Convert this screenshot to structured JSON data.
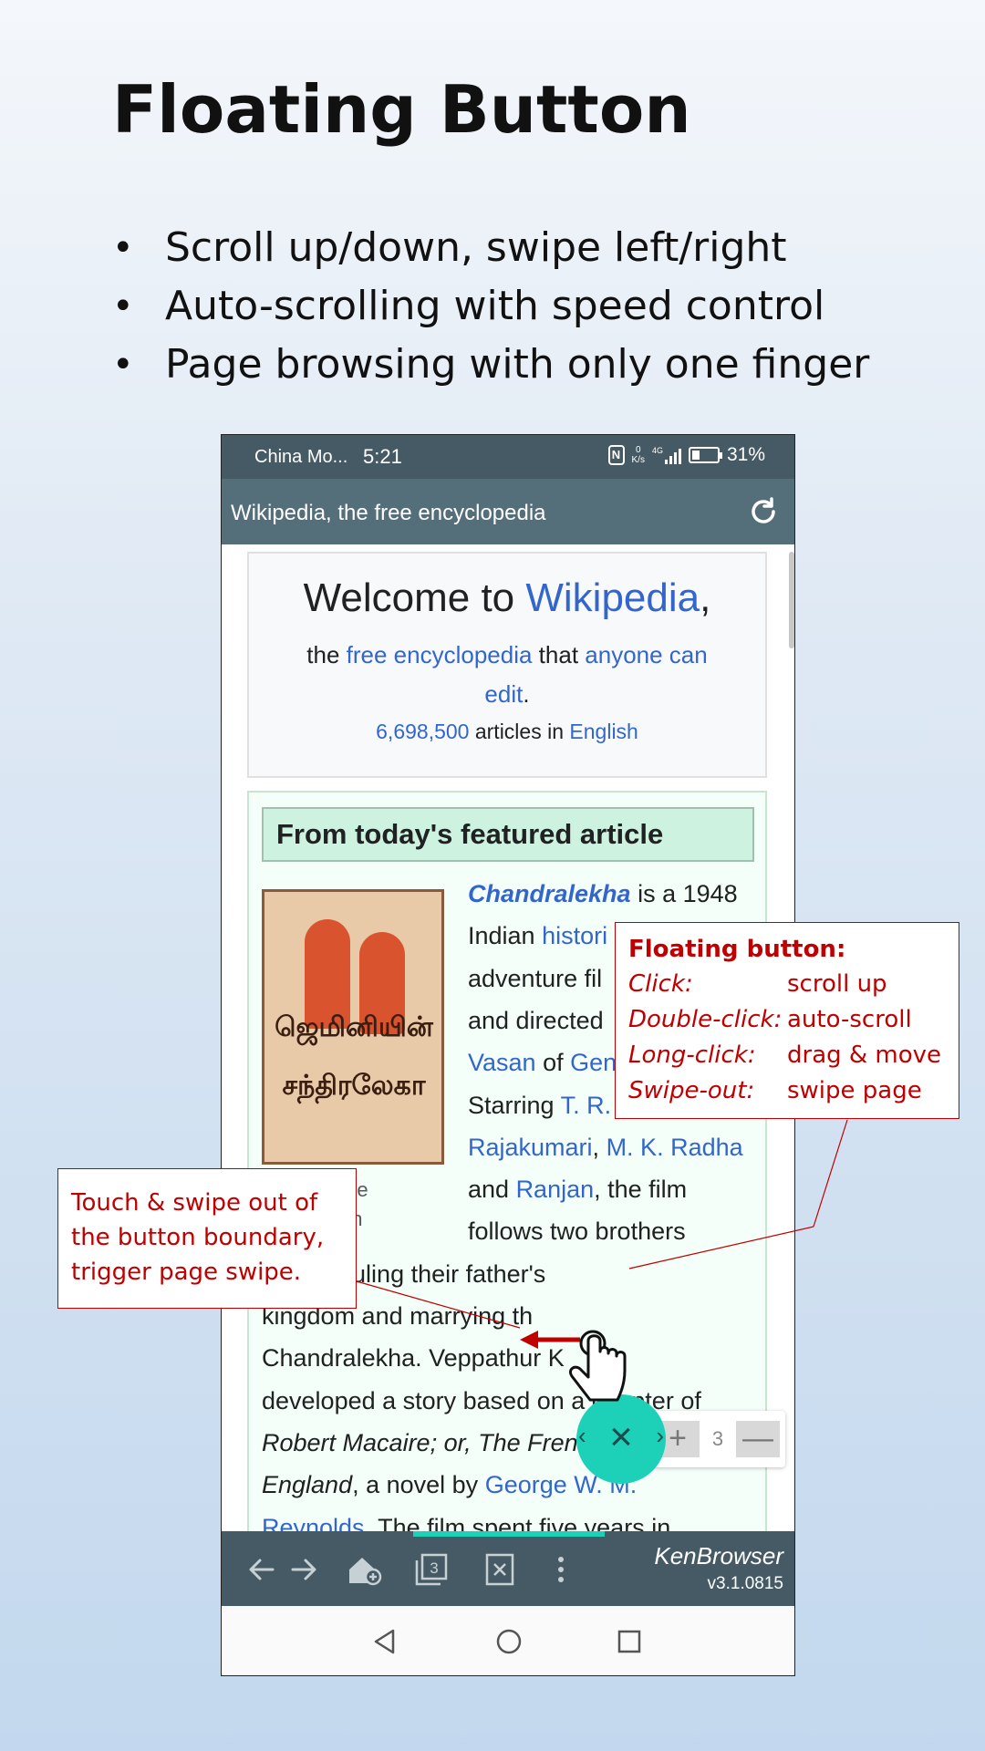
{
  "slide": {
    "title": "Floating Button",
    "bullets": [
      "Scroll up/down, swipe left/right",
      "Auto-scrolling with speed control",
      "Page browsing with only one finger"
    ]
  },
  "status_bar": {
    "carrier": "China Mo...",
    "time": "5:21",
    "net_speed_value": "0",
    "net_speed_unit": "K/s",
    "network": "4G",
    "battery_level": 0.31,
    "battery": "31%"
  },
  "url_bar": {
    "title": "Wikipedia, the free encyclopedia"
  },
  "welcome": {
    "prefix": "Welcome to ",
    "wikipedia_link": "Wikipedia",
    "suffix": ",",
    "line2_the": "the ",
    "free_encyclopedia_link": "free encyclopedia",
    "that": " that ",
    "anyone_link": "anyone can",
    "edit_link": "edit",
    "period": ".",
    "count_link": "6,698,500",
    "articles_in": " articles in ",
    "english_link": "English"
  },
  "featured": {
    "heading": "From today's featured article",
    "poster_text_top": "ஜெமினியின்",
    "poster_text_bottom": "சந்திரலேகா",
    "caption_line1": "the",
    "caption_line2": "on",
    "lines": [
      {
        "parts": [
          {
            "t": "Chandralekha",
            "s": "bi-link"
          },
          {
            "t": " is a 1948",
            "s": ""
          }
        ]
      },
      {
        "parts": [
          {
            "t": "Indian ",
            "s": ""
          },
          {
            "t": "histori",
            "s": "link"
          }
        ]
      },
      {
        "parts": [
          {
            "t": "adventure fil",
            "s": ""
          }
        ]
      },
      {
        "parts": [
          {
            "t": "and directed",
            "s": ""
          }
        ]
      },
      {
        "parts": [
          {
            "t": "Vasan",
            "s": "link"
          },
          {
            "t": " of ",
            "s": ""
          },
          {
            "t": "Gen",
            "s": "link"
          }
        ]
      },
      {
        "parts": [
          {
            "t": "Starring ",
            "s": ""
          },
          {
            "t": "T. R.",
            "s": "link"
          }
        ]
      },
      {
        "parts": [
          {
            "t": "Rajakumari",
            "s": "link"
          },
          {
            "t": ", ",
            "s": ""
          },
          {
            "t": "M. K. Radha",
            "s": "link"
          }
        ]
      },
      {
        "parts": [
          {
            "t": "and ",
            "s": ""
          },
          {
            "t": "Ranjan",
            "s": "link"
          },
          {
            "t": ", the film",
            "s": ""
          }
        ]
      },
      {
        "parts": [
          {
            "t": "follows two brothers",
            "s": ""
          }
        ]
      }
    ],
    "wide_lines": [
      {
        "parts": [
          {
            "t": "ht over ruling their father's",
            "s": ""
          }
        ]
      },
      {
        "parts": [
          {
            "t": "kingdom and marrying th",
            "s": ""
          }
        ]
      },
      {
        "parts": [
          {
            "t": "Chandralekha. Veppathur K",
            "s": ""
          }
        ]
      },
      {
        "parts": [
          {
            "t": "developed a story based on a chapter of",
            "s": ""
          }
        ]
      },
      {
        "parts": [
          {
            "t": "Robert Macaire; or, The French Bandit in",
            "s": "it"
          }
        ]
      },
      {
        "parts": [
          {
            "t": "England",
            "s": "it"
          },
          {
            "t": ", a novel by ",
            "s": ""
          },
          {
            "t": "George W. M.",
            "s": "link"
          }
        ]
      },
      {
        "parts": [
          {
            "t": "Reynolds",
            "s": "link"
          },
          {
            "t": ". The film spent five years in",
            "s": ""
          }
        ]
      }
    ]
  },
  "floating_button": {
    "close_glyph": "×",
    "left_glyph": "‹",
    "right_glyph": "›",
    "speed_plus": "+",
    "speed_value": "3",
    "speed_minus": "—"
  },
  "bottom_bar": {
    "brand": "KenBrowser",
    "version": "v3.1.0815",
    "tab_count": "3"
  },
  "callout_right": {
    "heading": "Floating button:",
    "rows": [
      {
        "k": "Click:",
        "v": "scroll up"
      },
      {
        "k": "Double-click:",
        "v": "auto-scroll"
      },
      {
        "k": "Long-click:",
        "v": "drag & move"
      },
      {
        "k": "Swipe-out:",
        "v": "swipe page"
      }
    ]
  },
  "callout_left": {
    "lines": [
      "Touch & swipe out of",
      "the button boundary,",
      "trigger page swipe."
    ]
  },
  "colors": {
    "accent": "#1dd1b8",
    "link": "#3366cc",
    "callout": "#c00000",
    "toolbar": "#455a64"
  }
}
